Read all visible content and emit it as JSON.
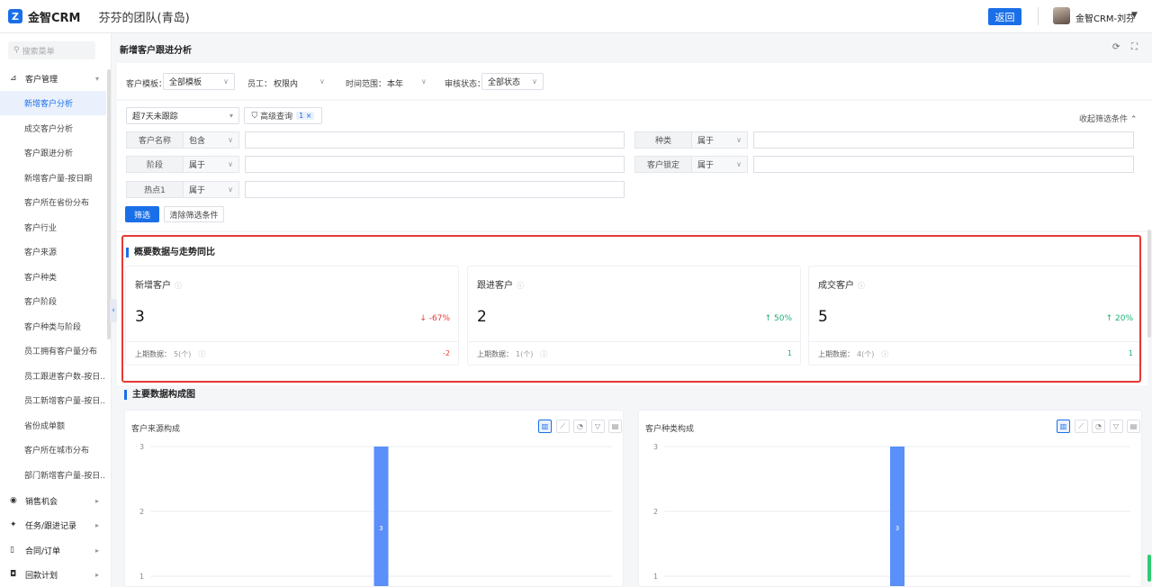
{
  "topbar": {
    "logo_mark": "Z",
    "logo_text": "金智CRM",
    "team": "芬芬的团队(青岛)",
    "back_label": "返回",
    "user_name": "金智CRM-刘芬",
    "user_caret": "▼"
  },
  "sidebar": {
    "search_placeholder": "搜索菜单",
    "groups": [
      {
        "icon": "chart-icon",
        "glyph": "⊿",
        "label": "客户管理",
        "caret": "▾"
      },
      {
        "icon": "opportunity-icon",
        "glyph": "◉",
        "label": "销售机会",
        "caret": "▸"
      },
      {
        "icon": "pin-icon",
        "glyph": "✦",
        "label": "任务/跟进记录",
        "caret": "▸"
      },
      {
        "icon": "document-icon",
        "glyph": "▯",
        "label": "合同/订单",
        "caret": "▸"
      },
      {
        "icon": "payment-icon",
        "glyph": "◘",
        "label": "回款计划",
        "caret": "▸"
      }
    ],
    "items": [
      "新增客户分析",
      "成交客户分析",
      "客户跟进分析",
      "新增客户量-按日期",
      "客户所在省份分布",
      "客户行业",
      "客户来源",
      "客户种类",
      "客户阶段",
      "客户种类与阶段",
      "员工拥有客户量分布",
      "员工跟进客户数-按日...",
      "员工新增客户量-按日...",
      "省份成单额",
      "客户所在城市分布",
      "部门新增客户量-按日..."
    ],
    "active_index": 0
  },
  "main": {
    "title": "新增客户跟进分析",
    "refresh_icon": "⟳",
    "fullscreen_icon": "⛶"
  },
  "filters": {
    "template_label": "客户模板：",
    "template_value": "全部模板",
    "staff_label": "员工：",
    "staff_value": "权限内",
    "time_label": "时间范围：",
    "time_value": "本年",
    "review_label": "审核状态：",
    "review_value": "全部状态",
    "preset_value": "超7天未跟踪",
    "advanced_label": "高级查询",
    "advanced_count": "1 ×",
    "collapse_label": "收起筛选条件",
    "fields": [
      {
        "label": "客户名称",
        "op": "包含"
      },
      {
        "label": "阶段",
        "op": "属于"
      },
      {
        "label": "热点1",
        "op": "属于"
      },
      {
        "label": "种类",
        "op": "属于"
      },
      {
        "label": "客户锁定",
        "op": "属于"
      }
    ],
    "filter_btn": "筛选",
    "clear_btn": "清除筛选条件"
  },
  "overview": {
    "title": "概要数据与走势同比",
    "prev_label": "上期数据：",
    "cards": [
      {
        "title": "新增客户",
        "value": "3",
        "trend": "↓ -67%",
        "dir": "down",
        "prev": "5(个)",
        "diff": "-2"
      },
      {
        "title": "跟进客户",
        "value": "2",
        "trend": "↑ 50%",
        "dir": "up",
        "prev": "1(个)",
        "diff": "1"
      },
      {
        "title": "成交客户",
        "value": "5",
        "trend": "↑ 20%",
        "dir": "up",
        "prev": "4(个)",
        "diff": "1"
      }
    ]
  },
  "composition": {
    "title": "主要数据构成图"
  },
  "chart_data": [
    {
      "type": "bar",
      "title": "客户来源构成",
      "categories": [
        ""
      ],
      "values": [
        3
      ],
      "data_labels": [
        "3"
      ],
      "ylim": [
        0,
        3
      ],
      "yticks": [
        "1",
        "2",
        "3"
      ],
      "grid": true,
      "bar_color": "#5b8ff9"
    },
    {
      "type": "bar",
      "title": "客户种类构成",
      "categories": [
        ""
      ],
      "values": [
        3
      ],
      "data_labels": [
        "3"
      ],
      "ylim": [
        0,
        3
      ],
      "yticks": [
        "1",
        "2",
        "3"
      ],
      "grid": true,
      "bar_color": "#5b8ff9"
    }
  ],
  "chart_tools": [
    {
      "icon": "bar-chart-icon",
      "glyph": "▥"
    },
    {
      "icon": "line-chart-icon",
      "glyph": "⟋"
    },
    {
      "icon": "pie-chart-icon",
      "glyph": "◔"
    },
    {
      "icon": "filter-icon",
      "glyph": "▽"
    },
    {
      "icon": "table-icon",
      "glyph": "▤"
    }
  ],
  "colors": {
    "accent": "#1a6fe8",
    "down": "#e53935",
    "up": "#1bb374",
    "highlight": "#e53935"
  }
}
